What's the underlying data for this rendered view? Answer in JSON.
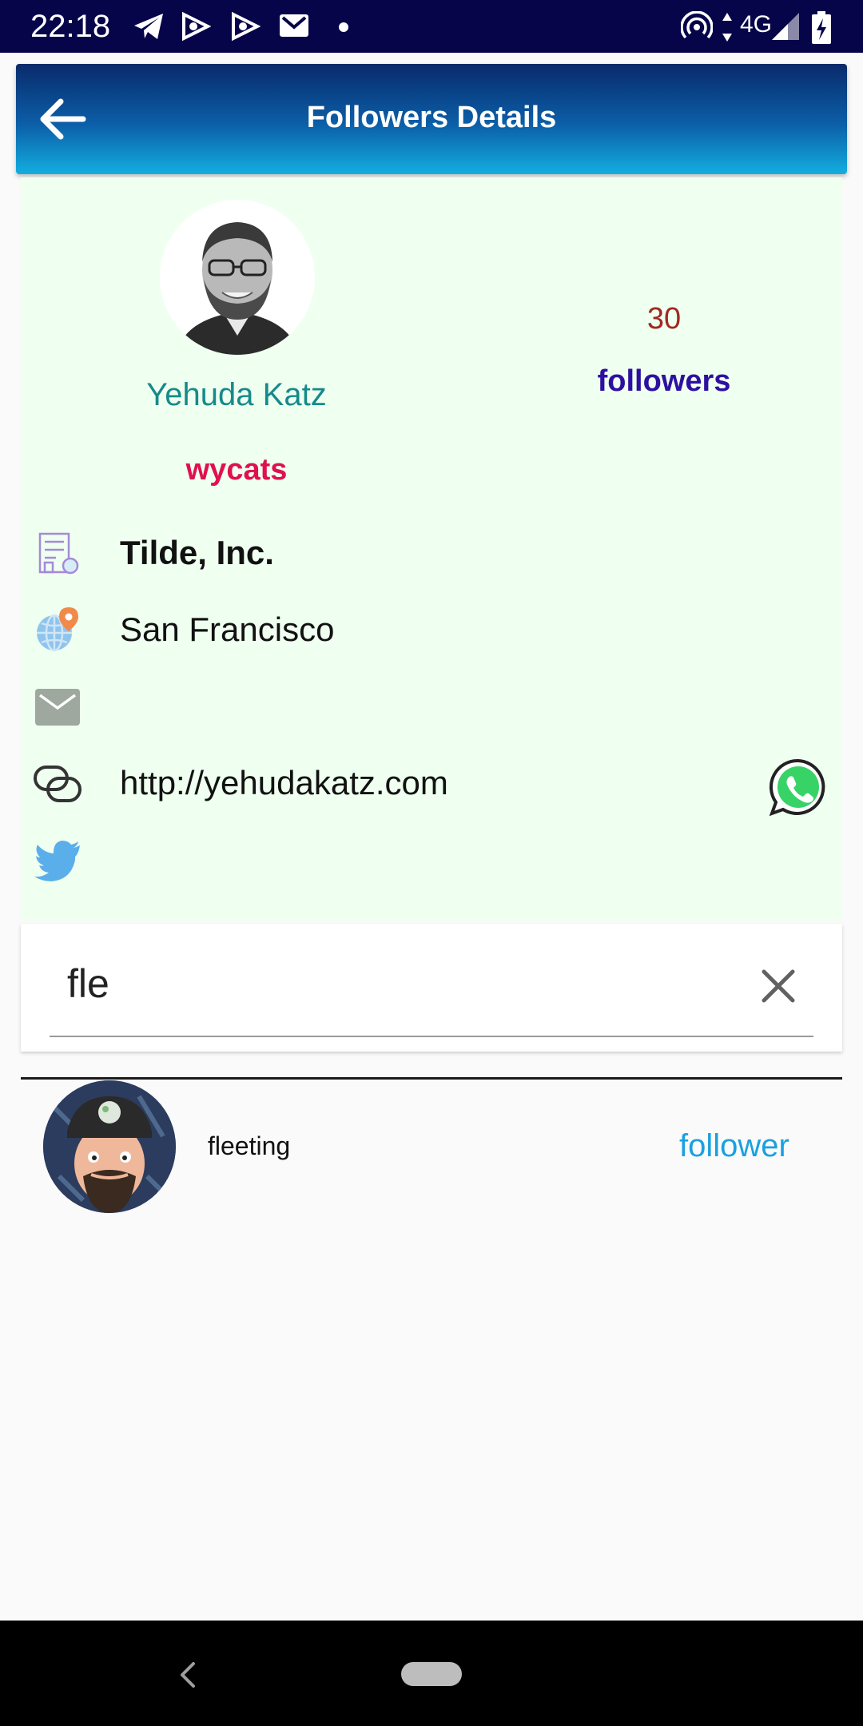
{
  "status_bar": {
    "time": "22:18",
    "network": "4G"
  },
  "app_bar": {
    "title": "Followers Details",
    "background_from": "#0a2a6b",
    "background_to": "#13aee0"
  },
  "profile": {
    "name": "Yehuda Katz",
    "login": "wycats",
    "followers_count": "30",
    "followers_label": "followers",
    "company": "Tilde, Inc.",
    "location": "San Francisco",
    "email": "",
    "blog": "http://yehudakatz.com",
    "twitter": "",
    "card_color": "#effff0",
    "name_color": "#168a8a",
    "login_color": "#e0104f"
  },
  "search": {
    "value": "fle",
    "placeholder": ""
  },
  "followers": [
    {
      "login": "fleeting",
      "type": "follower",
      "avatar_icon": "avatar-icon"
    }
  ],
  "icons": {
    "back": "arrow-left-icon",
    "company": "building-icon",
    "location": "globe-pin-icon",
    "email": "mail-icon",
    "blog": "link-icon",
    "twitter": "twitter-bird-icon",
    "share": "whatsapp-icon",
    "clear": "close-icon"
  }
}
